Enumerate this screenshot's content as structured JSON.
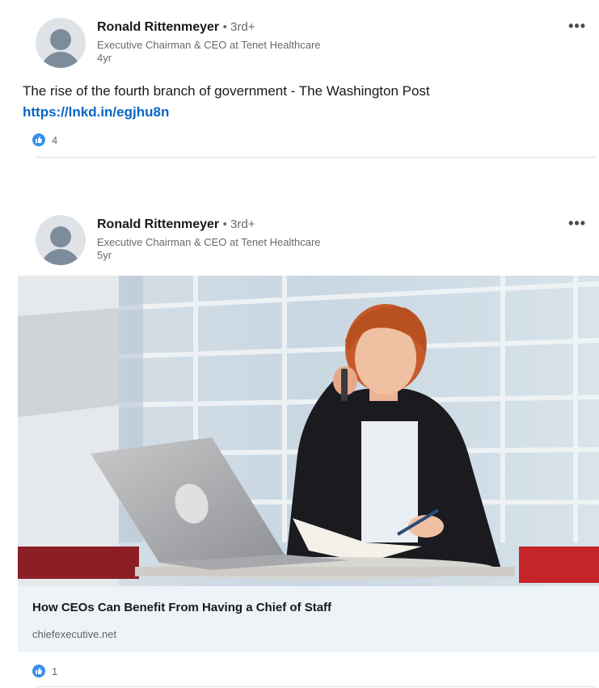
{
  "posts": [
    {
      "author": "Ronald Rittenmeyer",
      "degree": "• 3rd+",
      "headline": "Executive Chairman & CEO at Tenet Healthcare",
      "time": "4yr",
      "more_label": "•••",
      "text": "The rise of the fourth branch of government - The Washington Post",
      "link": "https://lnkd.in/egjhu8n",
      "reaction_count": "4"
    },
    {
      "author": "Ronald Rittenmeyer",
      "degree": "• 3rd+",
      "headline": "Executive Chairman & CEO at Tenet Healthcare",
      "time": "5yr",
      "more_label": "•••",
      "article_title": "How CEOs Can Benefit From Having a Chief of Staff",
      "article_source": "chiefexecutive.net",
      "reaction_count": "1"
    }
  ],
  "colors": {
    "link": "#0a66c2",
    "like": "#378fe9",
    "article_bg": "#eef3f8"
  },
  "icons": {
    "avatar": "person-avatar-icon",
    "like": "like-thumb-icon",
    "more": "ellipsis-icon"
  }
}
